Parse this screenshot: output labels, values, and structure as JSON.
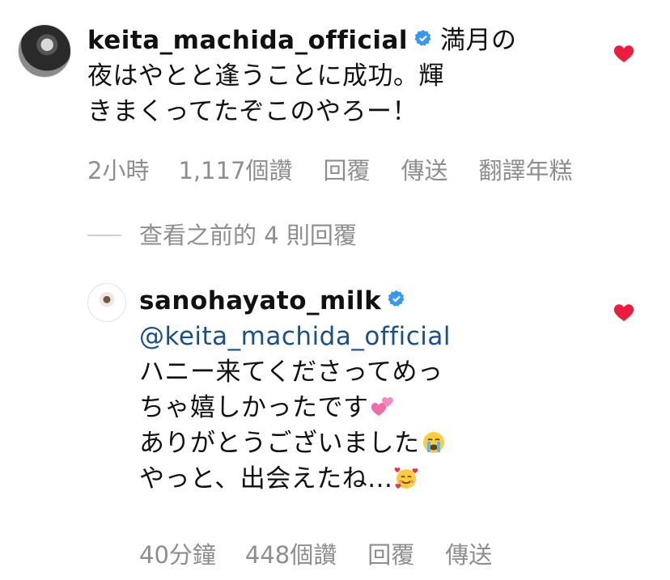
{
  "comments": [
    {
      "username": "keita_machida_official",
      "verified": true,
      "text_lines": [
        "満月の",
        "夜はやとと逢うことに成功。輝",
        "きまくってたぞこのやろー！"
      ],
      "meta": {
        "time": "2小時",
        "likes": "1,117個讚",
        "reply": "回覆",
        "send": "傳送",
        "translate": "翻譯年糕"
      }
    },
    {
      "username": "sanohayato_milk",
      "verified": true,
      "mention": "@keita_machida_official",
      "text_lines": [
        "ハニー来てくださってめっ",
        "ちゃ嬉しかったです",
        "ありがとうございました",
        "やっと、出会えたね..."
      ],
      "meta": {
        "time": "40分鐘",
        "likes": "448個讚",
        "reply": "回覆",
        "send": "傳送"
      }
    }
  ],
  "view_replies": "查看之前的 4 則回覆",
  "colors": {
    "heart": "#ed1c3c",
    "verified": "#3897f0",
    "meta": "#8e8e8e",
    "mention": "#1c4f86"
  },
  "emojis": [
    "two-hearts-icon",
    "crying-face-icon",
    "smiling-face-with-hearts-icon"
  ]
}
